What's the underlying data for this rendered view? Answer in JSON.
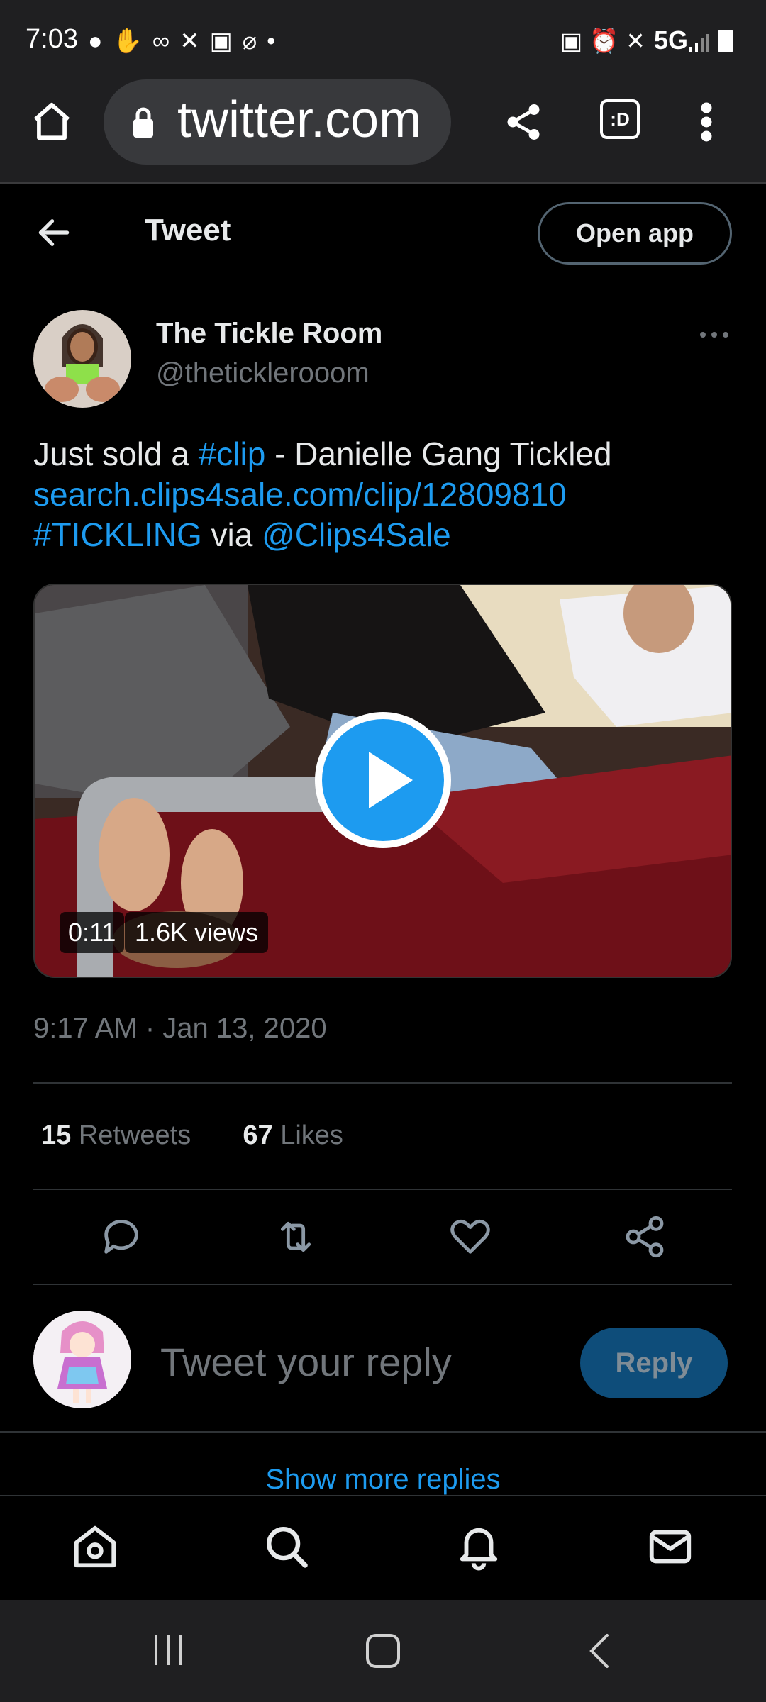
{
  "status_bar": {
    "time": "7:03",
    "network": "5G",
    "left_icons": [
      "chat-bubble-icon",
      "hand-icon",
      "voicemail-icon",
      "missed-call-icon",
      "u-app-icon",
      "notifications-off-icon",
      "dot-icon"
    ],
    "right_icons": [
      "lock-icon",
      "alarm-icon",
      "mute-icon",
      "signal-icon",
      "battery-icon"
    ]
  },
  "browser": {
    "url": "twitter.com",
    "tab_indicator": ":D"
  },
  "header": {
    "title": "Tweet",
    "open_app_label": "Open app"
  },
  "tweet": {
    "display_name": "The Tickle Room",
    "handle": "@theticklerooom",
    "text_parts": {
      "p1": "Just sold a ",
      "hashtag_clip": "#clip",
      "p2": " - Danielle Gang Tickled",
      "url": "search.clips4sale.com/clip/12809810",
      "hashtag_tickling": "#TICKLING",
      "p3": " via ",
      "mention": "@Clips4Sale"
    },
    "video": {
      "duration": "0:11",
      "views": "1.6K views"
    },
    "timestamp": "9:17 AM · Jan 13, 2020",
    "retweets_count": "15",
    "retweets_label": "Retweets",
    "likes_count": "67",
    "likes_label": "Likes"
  },
  "reply": {
    "placeholder": "Tweet your reply",
    "button_label": "Reply"
  },
  "show_more_replies": "Show more replies",
  "colors": {
    "accent": "#1d9bf0",
    "background": "#000000",
    "muted_text": "#71767b",
    "reply_button_disabled": "#0e4d7a"
  }
}
